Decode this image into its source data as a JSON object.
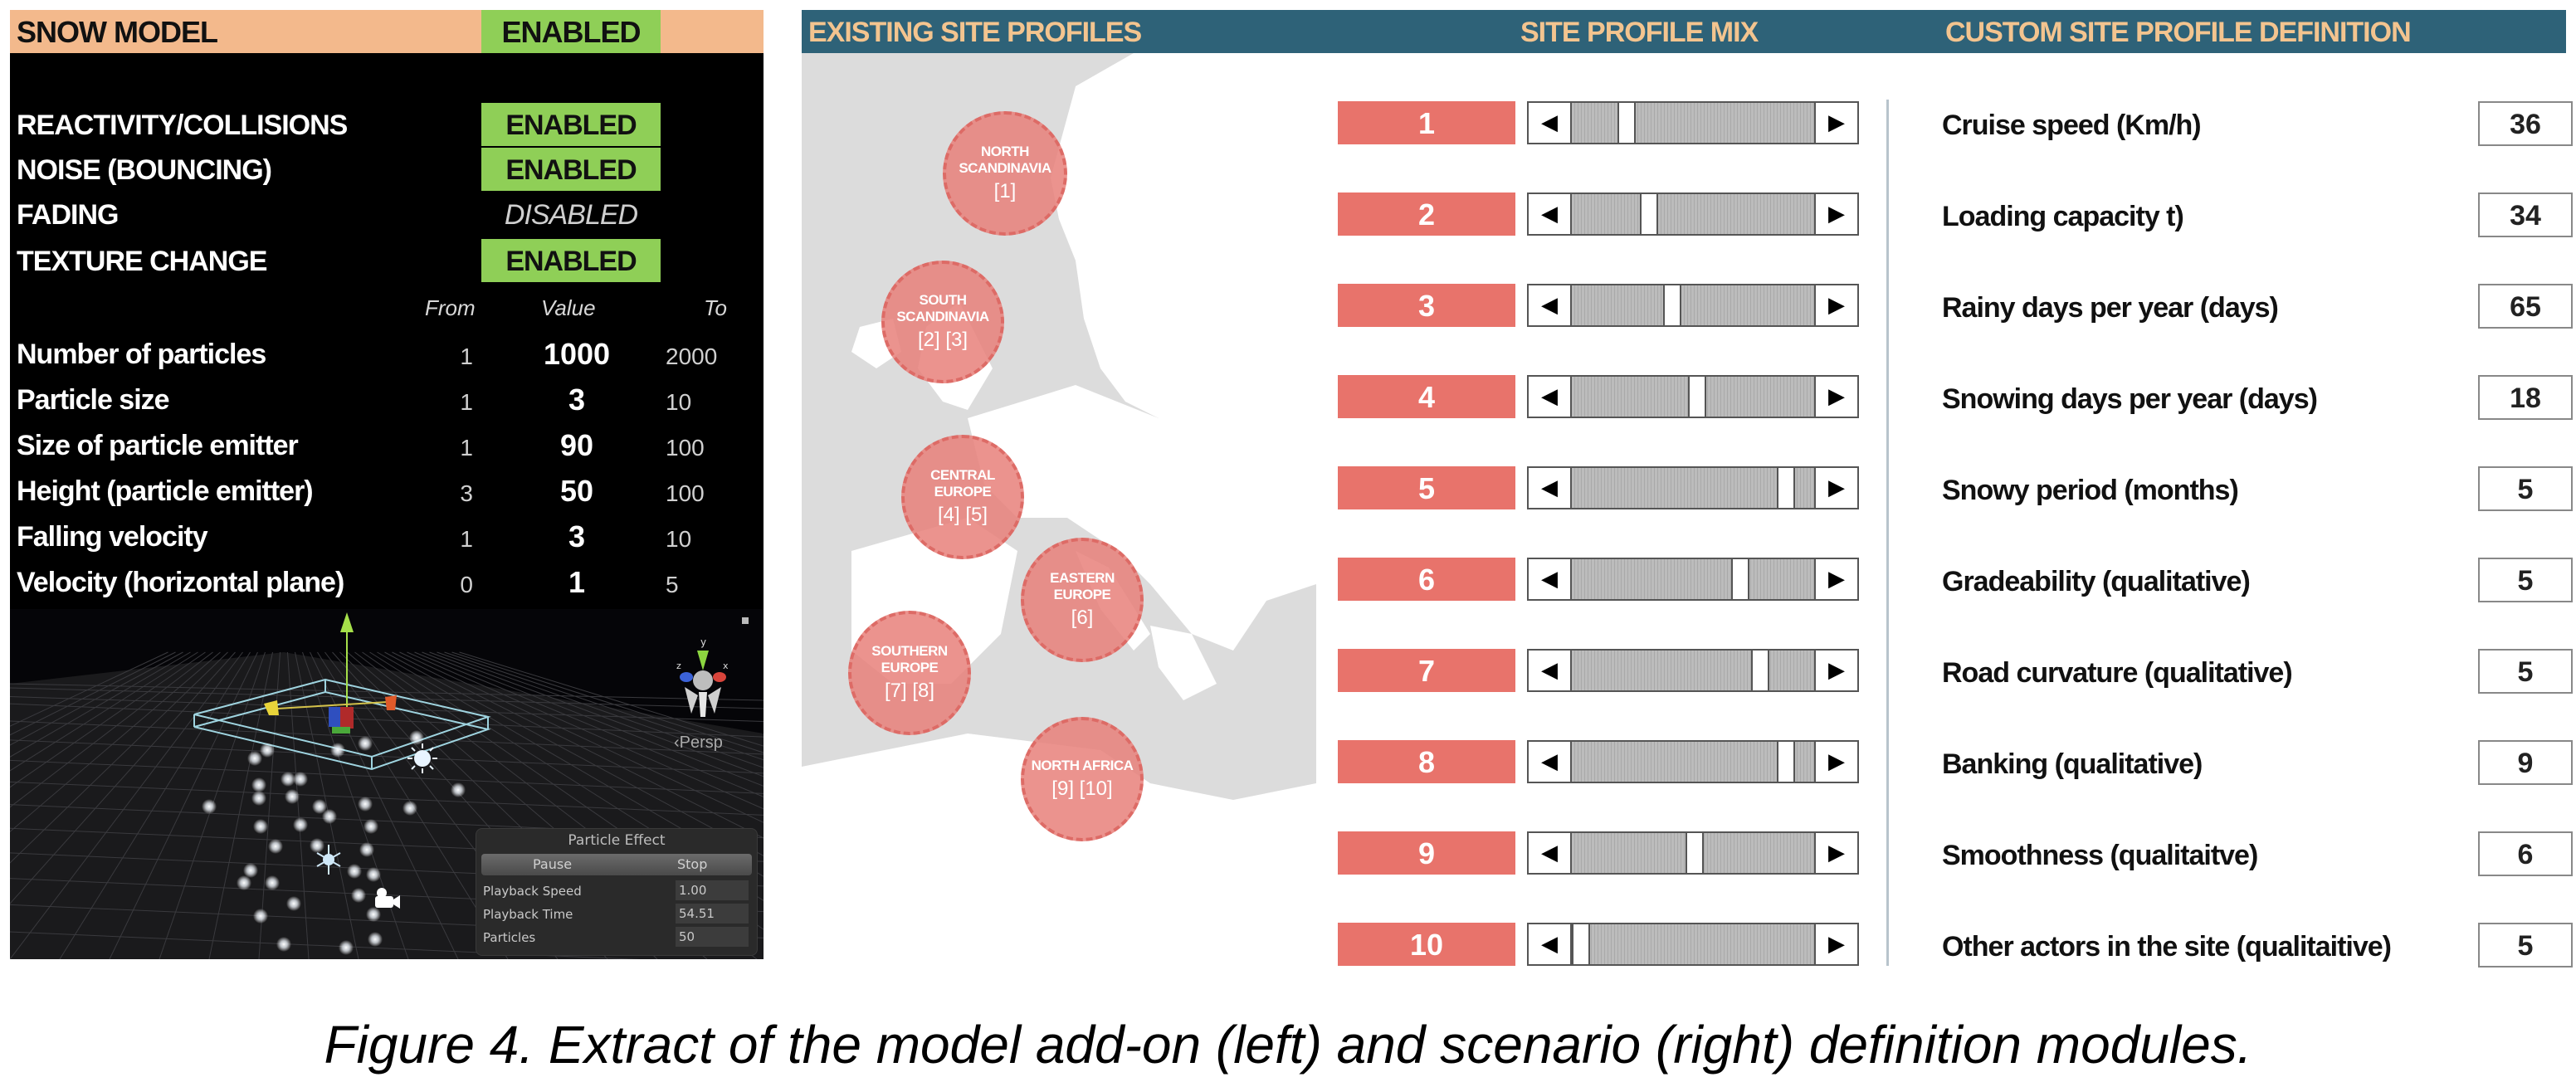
{
  "snow_model": {
    "title": "SNOW MODEL",
    "status": "ENABLED",
    "toggles": [
      {
        "label": "REACTIVITY/COLLISIONS",
        "status": "ENABLED",
        "enabled": true
      },
      {
        "label": "NOISE (BOUNCING)",
        "status": "ENABLED",
        "enabled": true
      },
      {
        "label": "FADING",
        "status": "DISABLED",
        "enabled": false
      },
      {
        "label": "TEXTURE CHANGE",
        "status": "ENABLED",
        "enabled": true
      }
    ],
    "columns": {
      "from": "From",
      "value": "Value",
      "to": "To"
    },
    "parameters": [
      {
        "name": "Number of particles",
        "from": "1",
        "value": "1000",
        "to": "2000"
      },
      {
        "name": "Particle size",
        "from": "1",
        "value": "3",
        "to": "10"
      },
      {
        "name": "Size of particle emitter",
        "from": "1",
        "value": "90",
        "to": "100"
      },
      {
        "name": "Height (particle emitter)",
        "from": "3",
        "value": "50",
        "to": "100"
      },
      {
        "name": "Falling velocity",
        "from": "1",
        "value": "3",
        "to": "10"
      },
      {
        "name": "Velocity (horizontal plane)",
        "from": "0",
        "value": "1",
        "to": "5"
      }
    ],
    "viewport": {
      "gizmo_axes": {
        "y": "y",
        "x": "x",
        "z": "z"
      },
      "projection_label": "‹Persp",
      "particle_effect": {
        "title": "Particle Effect",
        "pause_label": "Pause",
        "stop_label": "Stop",
        "rows": [
          {
            "label": "Playback Speed",
            "value": "1.00"
          },
          {
            "label": "Playback Time",
            "value": "54.51"
          },
          {
            "label": "Particles",
            "value": "50"
          }
        ]
      }
    }
  },
  "scenario": {
    "headers": {
      "existing": "EXISTING SITE PROFILES",
      "mix": "SITE PROFILE MIX",
      "custom": "CUSTOM SITE PROFILE DEFINITION"
    },
    "regions": [
      {
        "name": "NORTH SCANDINAVIA",
        "ids": "[1]"
      },
      {
        "name": "SOUTH SCANDINAVIA",
        "ids": "[2] [3]"
      },
      {
        "name": "CENTRAL EUROPE",
        "ids": "[4] [5]"
      },
      {
        "name": "EASTERN EUROPE",
        "ids": "[6]"
      },
      {
        "name": "SOUTHERN EUROPE",
        "ids": "[7] [8]"
      },
      {
        "name": "NORTH AFRICA",
        "ids": "[9] [10]"
      }
    ],
    "mix": [
      {
        "label": "1",
        "fraction": 0.2
      },
      {
        "label": "2",
        "fraction": 0.3
      },
      {
        "label": "3",
        "fraction": 0.4
      },
      {
        "label": "4",
        "fraction": 0.51
      },
      {
        "label": "5",
        "fraction": 0.9
      },
      {
        "label": "6",
        "fraction": 0.7
      },
      {
        "label": "7",
        "fraction": 0.79
      },
      {
        "label": "8",
        "fraction": 0.9
      },
      {
        "label": "9",
        "fraction": 0.5
      },
      {
        "label": "10",
        "fraction": 0.0
      }
    ],
    "arrows": {
      "left": "◀",
      "right": "▶"
    },
    "definition": [
      {
        "label": "Cruise speed (Km/h)",
        "value": "36"
      },
      {
        "label": "Loading capacity t)",
        "value": "34"
      },
      {
        "label": "Rainy days per year (days)",
        "value": "65"
      },
      {
        "label": "Snowing days per year (days)",
        "value": "18"
      },
      {
        "label": "Snowy period (months)",
        "value": "5"
      },
      {
        "label": "Gradeability (qualitative)",
        "value": "5"
      },
      {
        "label": "Road curvature (qualitative)",
        "value": "5"
      },
      {
        "label": "Banking (qualitative)",
        "value": "9"
      },
      {
        "label": "Smoothness (qualitaitve)",
        "value": "6"
      },
      {
        "label": "Other actors in the site (qualitaitive)",
        "value": "5"
      }
    ]
  },
  "colors": {
    "snow_header": "#f3b98c",
    "enabled_green": "#8fcf57",
    "scenario_header": "#2e6278",
    "header_text": "#f3c48f",
    "profile_red": "#e8736b"
  },
  "caption": "Figure 4. Extract of the model add-on (left) and scenario (right) definition modules."
}
